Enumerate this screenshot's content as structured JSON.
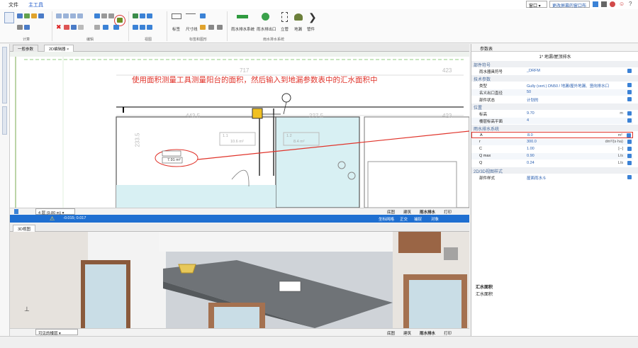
{
  "menu": {
    "file": "文件",
    "main": "主工具"
  },
  "top_right": {
    "window": "窗口",
    "layout": "更改屏幕的窗口布置"
  },
  "ribbon": {
    "groups": [
      "计算",
      "编辑",
      "视图",
      "标签和图形",
      "雨水排水系统"
    ],
    "big_buttons": [
      "雨水排水系统",
      "雨水排出口",
      "立管",
      "地漏",
      "管件"
    ],
    "small_labels": [
      "标签",
      "尺寸线"
    ]
  },
  "plan_view": {
    "tabs": [
      "一般参数",
      "2D编辑器"
    ],
    "annotation": "使用面积测量工具测量阳台的面积，然后输入到地漏参数表中的汇水面积中",
    "dimensions": [
      "717",
      "423",
      "443.5",
      "227.5",
      "423",
      "233.5"
    ],
    "area_labels": [
      "1.1",
      "10.6 m²",
      "1.2",
      "8.4 m²"
    ],
    "measure_labels": [
      "7.91 m²"
    ],
    "floor_select": "4 层 (9.80 m)",
    "status_tabs": [
      "底图",
      "建筑",
      "雨水排水",
      "打印"
    ],
    "coords": "-0.015; 0.017",
    "blue_bar_items": [
      "坐标网格",
      "正交",
      "捕捉",
      "对象"
    ]
  },
  "view3d": {
    "tab": "3D视图",
    "visible_floor_select": "可见的楼层",
    "status_tabs": [
      "底图",
      "建筑",
      "雨水排水",
      "打印"
    ]
  },
  "params": {
    "title": "参数表",
    "subtitle": "1* 地漏/屋顶排水",
    "sections": [
      {
        "name": "部件符号",
        "rows": [
          {
            "k": "雨水器具符号",
            "v": "_DRFM"
          }
        ]
      },
      {
        "name": "技术参数",
        "rows": [
          {
            "k": "类型",
            "v": "Gully (vert.) DN50 / 地漏/屋外地漏、竖向排水口"
          },
          {
            "k": "名义出口直径",
            "v": "50"
          },
          {
            "k": "部件状态",
            "v": "计划的"
          }
        ]
      },
      {
        "name": "位置",
        "rows": [
          {
            "k": "标高",
            "v": "9.70",
            "u": "m"
          },
          {
            "k": "楼层标高平面",
            "v": "4"
          }
        ]
      },
      {
        "name": "雨水排水系统",
        "rows": [
          {
            "k": "A",
            "v": "8.0",
            "u": "m²"
          },
          {
            "k": "r",
            "v": "300.0",
            "u": "dm³/(s·ha)"
          },
          {
            "k": "C",
            "v": "1.00",
            "u": "[--]"
          },
          {
            "k": "Q max",
            "v": "0.90",
            "u": "L/s"
          },
          {
            "k": "Q",
            "v": "0.24",
            "u": "L/s"
          }
        ]
      },
      {
        "name": "2D/3D视图样式",
        "rows": [
          {
            "k": "部件样式",
            "v": "屋面雨水斗"
          }
        ]
      }
    ],
    "help_title": "汇水面积",
    "help_text": "汇水面积"
  },
  "colors": {
    "accent": "#1f6fd1",
    "annotation": "#e0342b",
    "room_fill": "#d8f0f3"
  }
}
